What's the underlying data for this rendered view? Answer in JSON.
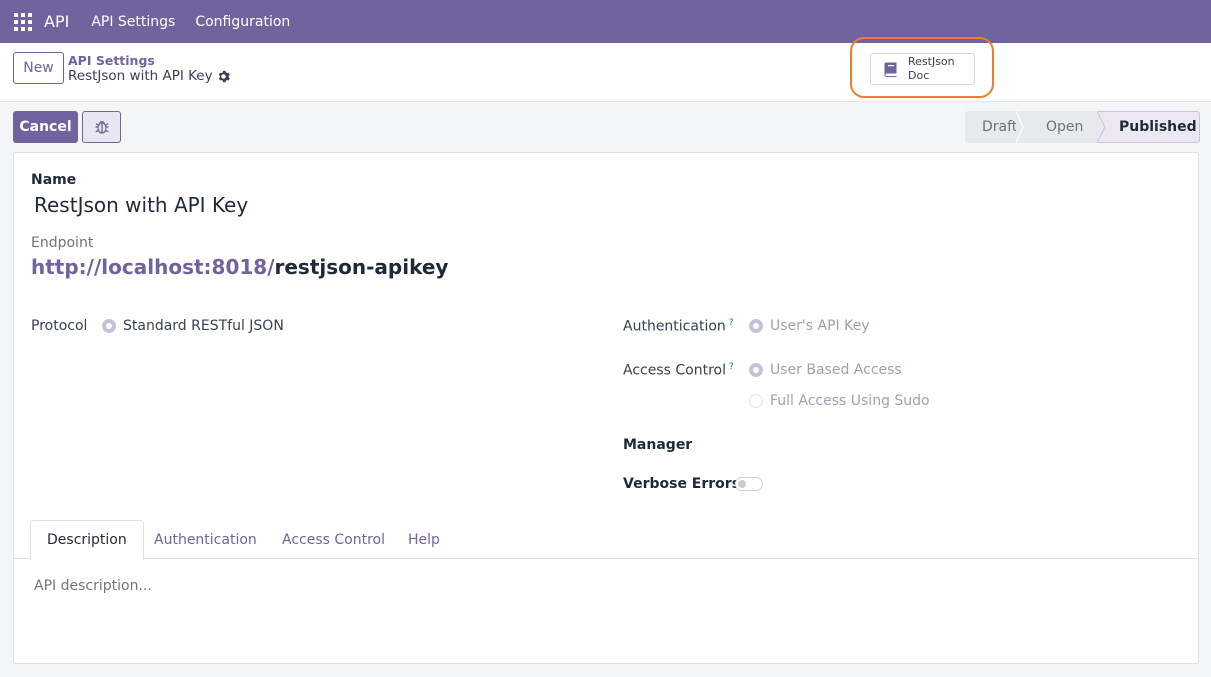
{
  "navbar": {
    "brand": "API",
    "menus": [
      "API Settings",
      "Configuration"
    ]
  },
  "control": {
    "new_label": "New",
    "breadcrumb_parent": "API Settings",
    "breadcrumb_current": "RestJson with API Key",
    "doc_button_line1": "RestJson",
    "doc_button_line2": "Doc"
  },
  "actions": {
    "cancel_label": "Cancel"
  },
  "statusbar": {
    "stages": [
      "Draft",
      "Open",
      "Published"
    ],
    "current": "Published"
  },
  "form": {
    "name_label": "Name",
    "name_value": "RestJson with API Key",
    "endpoint_label": "Endpoint",
    "endpoint_base": "http://localhost:8018/",
    "endpoint_path": "restjson-apikey",
    "protocol_label": "Protocol",
    "protocol_value": "Standard RESTful JSON",
    "authentication_label": "Authentication",
    "authentication_value": "User's API Key",
    "access_control_label": "Access Control",
    "access_control_options": [
      "User Based Access",
      "Full Access Using Sudo"
    ],
    "access_control_selected": "User Based Access",
    "manager_label": "Manager",
    "verbose_errors_label": "Verbose Errors",
    "verbose_errors_enabled": false,
    "help_mark": "?"
  },
  "tabs": {
    "items": [
      "Description",
      "Authentication",
      "Access Control",
      "Help"
    ],
    "active": "Description",
    "description_placeholder": "API description..."
  },
  "colors": {
    "brand": "#71639e",
    "highlight": "#f07c28",
    "help": "#017e84"
  }
}
